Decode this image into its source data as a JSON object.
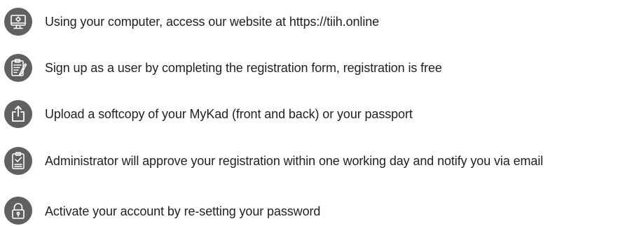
{
  "steps": [
    {
      "icon": "computer-monitor-icon",
      "text": "Using your computer, access our website at https://tiih.online"
    },
    {
      "icon": "clipboard-form-icon",
      "text": "Sign up as a user by completing the registration form, registration is free"
    },
    {
      "icon": "upload-share-icon",
      "text": "Upload a softcopy of your MyKad (front and back) or your passport"
    },
    {
      "icon": "clipboard-check-icon",
      "text": "Administrator will approve your registration within one working day and notify you via email"
    },
    {
      "icon": "padlock-icon",
      "text": "Activate your account by re-setting your password"
    }
  ],
  "colors": {
    "icon_background": "#606060",
    "icon_foreground": "#ffffff",
    "text": "#222222"
  }
}
